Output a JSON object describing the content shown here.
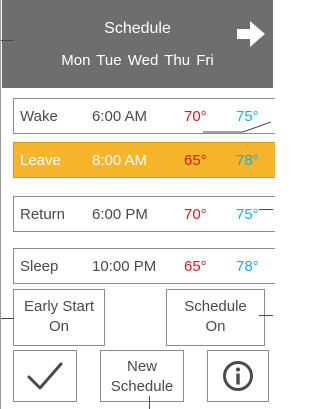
{
  "header": {
    "title": "Schedule",
    "days": "Mon Tue Wed Thu Fri",
    "next_icon": "arrow-right-icon"
  },
  "periods": [
    {
      "name": "Wake",
      "time": "6:00 AM",
      "heat": "70°",
      "cool": "75°",
      "active": false
    },
    {
      "name": "Leave",
      "time": "8:00 AM",
      "heat": "65°",
      "cool": "78°",
      "active": true
    },
    {
      "name": "Return",
      "time": "6:00 PM",
      "heat": "70°",
      "cool": "75°",
      "active": false
    },
    {
      "name": "Sleep",
      "time": "10:00 PM",
      "heat": "65°",
      "cool": "78°",
      "active": false
    }
  ],
  "buttons": {
    "early_start_line1": "Early Start",
    "early_start_line2": "On",
    "schedule_line1": "Schedule",
    "schedule_line2": "On",
    "new_schedule_line1": "New",
    "new_schedule_line2": "Schedule",
    "confirm_icon": "checkmark-icon",
    "info_icon": "info-icon"
  },
  "colors": {
    "header_bg": "#6e6e6e",
    "active_row": "#f7b52c",
    "heat": "#d6191f",
    "cool": "#19aee0"
  }
}
